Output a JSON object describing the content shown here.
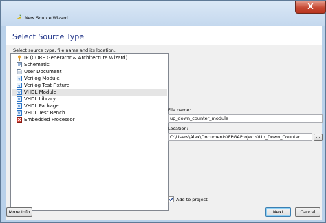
{
  "window": {
    "title": "New Source Wizard",
    "close_glyph": "X"
  },
  "header": {
    "title": "Select Source Type"
  },
  "instructions": "Select source type, file name and its location.",
  "source_types": [
    {
      "label": "IP (CORE Generator & Architecture Wizard)",
      "icon": "ip-core-icon",
      "color": "#d98a1a"
    },
    {
      "label": "Schematic",
      "icon": "schematic-icon",
      "color": "#3a6fb4"
    },
    {
      "label": "User Document",
      "icon": "document-icon",
      "color": "#3a6fb4"
    },
    {
      "label": "Verilog Module",
      "icon": "verilog-module-icon",
      "color": "#2a74c7"
    },
    {
      "label": "Verilog Test Fixture",
      "icon": "verilog-test-fixture-icon",
      "color": "#2a74c7"
    },
    {
      "label": "VHDL Module",
      "icon": "vhdl-module-icon",
      "color": "#2a74c7",
      "selected": true
    },
    {
      "label": "VHDL Library",
      "icon": "vhdl-library-icon",
      "color": "#2a74c7"
    },
    {
      "label": "VHDL Package",
      "icon": "vhdl-package-icon",
      "color": "#2a74c7"
    },
    {
      "label": "VHDL Test Bench",
      "icon": "vhdl-test-bench-icon",
      "color": "#2a74c7"
    },
    {
      "label": "Embedded Processor",
      "icon": "embedded-processor-icon",
      "color": "#c0282b"
    }
  ],
  "file_name": {
    "label": "File name:",
    "value": "up_down_counter_module"
  },
  "location": {
    "label": "Location:",
    "value": "C:\\Users\\Alex\\Documents\\FPGAProjects\\Up_Down_Counter",
    "browse_label": "..."
  },
  "add_to_project": {
    "label": "Add to project",
    "checked": true
  },
  "buttons": {
    "more_info": "More Info",
    "next": "Next",
    "cancel": "Cancel"
  }
}
